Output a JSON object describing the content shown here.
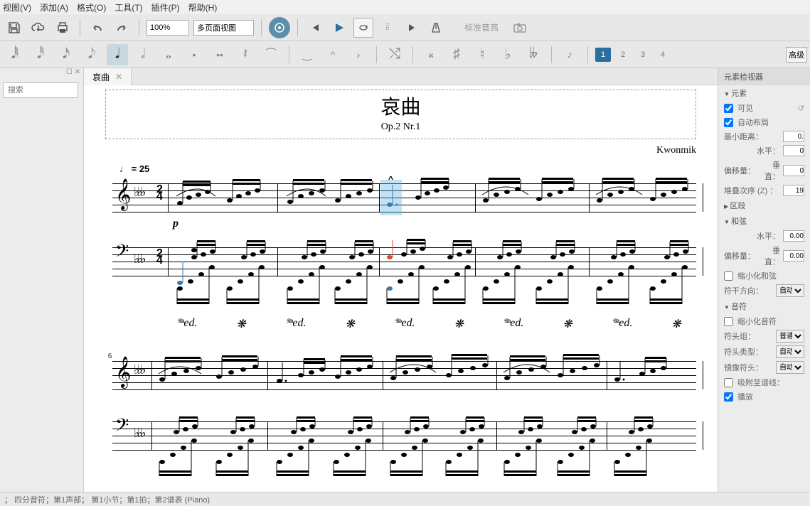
{
  "menu": {
    "view": "视图(V)",
    "add": "添加(A)",
    "format": "格式(O)",
    "tools": "工具(T)",
    "plugins": "插件(P)",
    "help": "帮助(H)"
  },
  "toolbar": {
    "zoom": "100%",
    "view_mode": "多页面视图",
    "std_pitch": "标准音高"
  },
  "voices": {
    "v1": "1",
    "v2": "2",
    "v3": "3",
    "v4": "4"
  },
  "adv_button": "高级",
  "search_placeholder": "搜索",
  "tab": {
    "name": "哀曲"
  },
  "score": {
    "title": "哀曲",
    "subtitle": "Op.2 Nr.1",
    "composer": "Kwonmik",
    "tempo_note": "♩",
    "tempo_eq": " = 25",
    "dynamic": "p",
    "time_top": "2",
    "time_bot": "4",
    "measure_num": "6",
    "pedal": "𝆮ed.",
    "ped_star": "❋"
  },
  "inspector": {
    "title": "元素检视器",
    "sec_element": "元素",
    "visible": "可见",
    "autolayout": "自动布局",
    "min_dist": "最小距离：",
    "min_dist_val": "0.",
    "offset": "偏移量：",
    "horiz": "水平：",
    "vert": "垂直：",
    "horiz_val": "0",
    "vert_val": "0",
    "stack": "堆叠次序 (Z) ：",
    "stack_val": "19",
    "sec_segment": "区段",
    "sec_chord": "和弦",
    "chord_off_h": "0.00",
    "chord_off_v": "0.00",
    "small_chord": "缩小化和弦",
    "stem_dir": "符干方向：",
    "stem_dir_val": "自动",
    "sec_note": "音符",
    "small_note": "缩小化音符",
    "head_group": "符头组：",
    "head_group_val": "普通",
    "head_type": "符头类型：",
    "head_type_val": "自动",
    "mirror": "镜像符头：",
    "mirror_val": "自动",
    "snap": "吸附至谱线：",
    "play": "播放"
  },
  "status": "；  四分音符；第1声部；  第1小节；第1拍；第2谱表 (Piano)"
}
